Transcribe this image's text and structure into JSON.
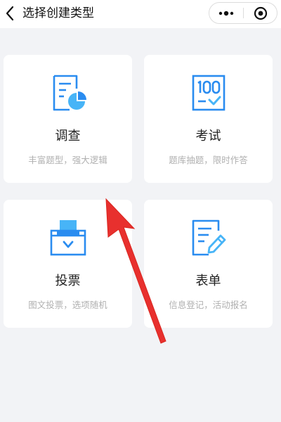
{
  "header": {
    "title": "选择创建类型",
    "back_icon": "chevron-left-icon",
    "more_icon": "more-dots-icon",
    "close_icon": "target-circle-icon"
  },
  "cards": [
    {
      "title": "调查",
      "desc": "丰富题型，强大逻辑",
      "icon": "survey-document-chart-icon"
    },
    {
      "title": "考试",
      "desc": "题库抽题，限时作答",
      "icon": "exam-score-100-icon"
    },
    {
      "title": "投票",
      "desc": "图文投票，选项随机",
      "icon": "ballot-box-icon"
    },
    {
      "title": "表单",
      "desc": "信息登记，活动报名",
      "icon": "form-edit-pencil-icon"
    }
  ],
  "colors": {
    "accent": "#2a8cf0",
    "accent_light": "#47b4f7",
    "background": "#f2f3f6",
    "card": "#ffffff",
    "annotation_arrow": "#e8302e"
  }
}
